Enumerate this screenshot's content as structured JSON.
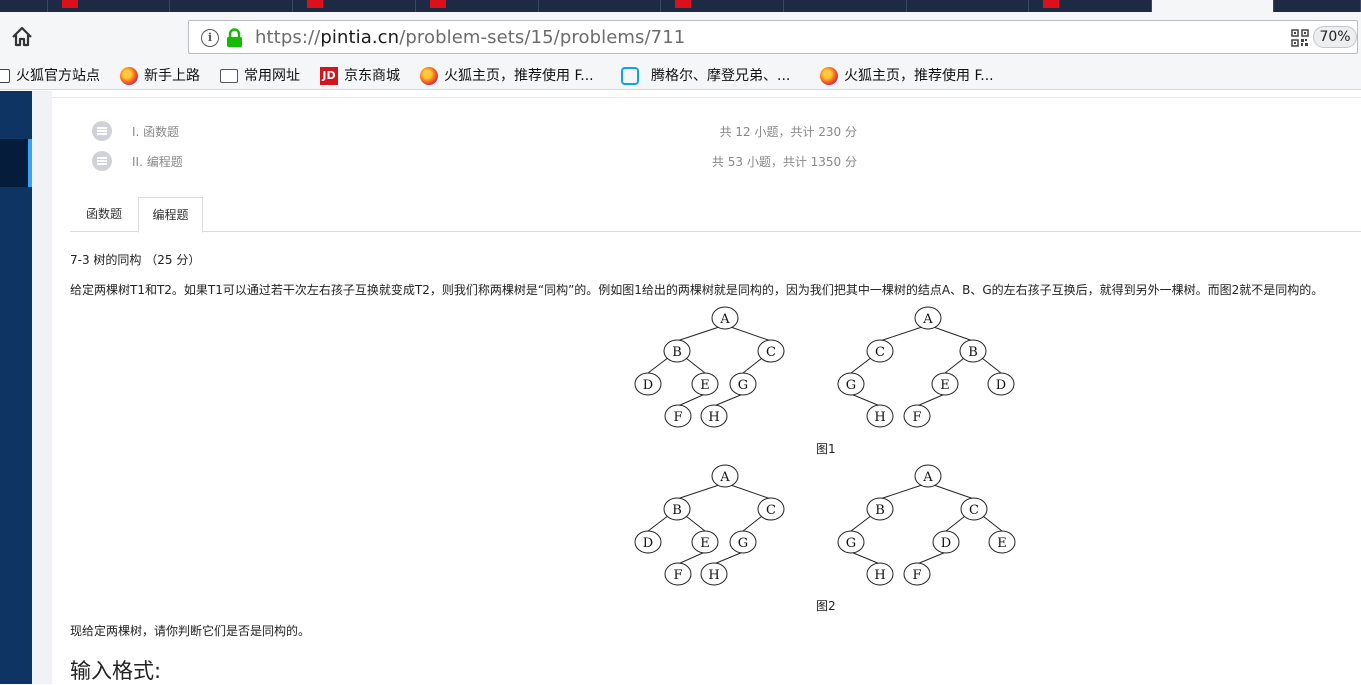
{
  "browser": {
    "url_scheme": "https://",
    "url_host": "pintia.cn",
    "url_path": "/problem-sets/15/problems/711",
    "zoom": "70%"
  },
  "bookmarks": [
    {
      "label": "火狐官方站点",
      "icon": "firefox-icon"
    },
    {
      "label": "新手上路",
      "icon": "firefox-icon"
    },
    {
      "label": "常用网址",
      "icon": "folder-icon"
    },
    {
      "label": "京东商城",
      "icon": "jd-icon"
    },
    {
      "label": "火狐主页，推荐使用 F...",
      "icon": "firefox-icon"
    },
    {
      "label": "腾格尔、摩登兄弟、...",
      "icon": "bilibili-icon"
    },
    {
      "label": "火狐主页，推荐使用 F...",
      "icon": "firefox-icon"
    }
  ],
  "jd_icon_text": "JD",
  "problem_set": {
    "sections": [
      {
        "name": "I. 函数题",
        "score": "共 12 小题，共计 230 分"
      },
      {
        "name": "II. 编程题",
        "score": "共 53 小题，共计 1350 分"
      }
    ],
    "tabs": [
      {
        "label": "函数题",
        "selected": false
      },
      {
        "label": "编程题",
        "selected": true
      }
    ]
  },
  "problem": {
    "title": "7-3 树的同构 （25 分）",
    "description": "给定两棵树T1和T2。如果T1可以通过若干次左右孩子互换就变成T2，则我们称两棵树是“同构”的。例如图1给出的两棵树就是同构的，因为我们把其中一棵树的结点A、B、G的左右孩子互换后，就得到另外一棵树。而图2就不是同构的。",
    "question": "现给定两棵树，请你判断它们是否是同构的。",
    "input_format_heading": "输入格式:",
    "figures": [
      {
        "caption": "图1",
        "trees": [
          {
            "nodes": [
              "A",
              "B",
              "C",
              "D",
              "E",
              "G",
              "F",
              "H"
            ],
            "edges": [
              [
                "A",
                "B"
              ],
              [
                "A",
                "C"
              ],
              [
                "B",
                "D"
              ],
              [
                "B",
                "E"
              ],
              [
                "C",
                "G"
              ],
              [
                "E",
                "F"
              ],
              [
                "G",
                "H"
              ]
            ]
          },
          {
            "nodes": [
              "A",
              "C",
              "B",
              "G",
              "E",
              "D",
              "H",
              "F"
            ],
            "edges": [
              [
                "A",
                "C"
              ],
              [
                "A",
                "B"
              ],
              [
                "C",
                "G"
              ],
              [
                "B",
                "E"
              ],
              [
                "B",
                "D"
              ],
              [
                "G",
                "H"
              ],
              [
                "E",
                "F"
              ]
            ]
          }
        ]
      },
      {
        "caption": "图2",
        "trees": [
          {
            "nodes": [
              "A",
              "B",
              "C",
              "D",
              "E",
              "G",
              "F",
              "H"
            ],
            "edges": [
              [
                "A",
                "B"
              ],
              [
                "A",
                "C"
              ],
              [
                "B",
                "D"
              ],
              [
                "B",
                "E"
              ],
              [
                "C",
                "G"
              ],
              [
                "E",
                "F"
              ],
              [
                "G",
                "H"
              ]
            ]
          },
          {
            "nodes": [
              "A",
              "B",
              "C",
              "G",
              "D",
              "E",
              "H",
              "F"
            ],
            "edges": [
              [
                "A",
                "B"
              ],
              [
                "A",
                "C"
              ],
              [
                "B",
                "G"
              ],
              [
                "C",
                "D"
              ],
              [
                "C",
                "E"
              ],
              [
                "G",
                "H"
              ],
              [
                "D",
                "F"
              ]
            ]
          }
        ]
      }
    ]
  }
}
